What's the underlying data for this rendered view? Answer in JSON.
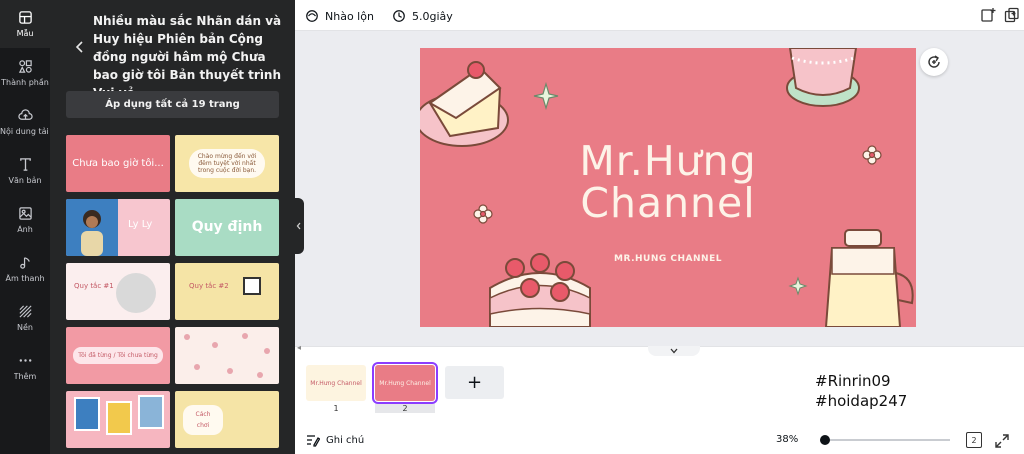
{
  "rail": {
    "items": [
      {
        "label": "Mẫu",
        "icon": "template-icon",
        "active": true
      },
      {
        "label": "Thành phần",
        "icon": "elements-icon"
      },
      {
        "label": "Nội dung tải lên",
        "icon": "upload-cloud-icon"
      },
      {
        "label": "Văn bản",
        "icon": "text-icon"
      },
      {
        "label": "Ảnh",
        "icon": "photo-icon"
      },
      {
        "label": "Âm thanh",
        "icon": "music-icon"
      },
      {
        "label": "Nền",
        "icon": "background-icon"
      },
      {
        "label": "Thêm",
        "icon": "more-icon"
      }
    ]
  },
  "panel": {
    "title": "Nhiều màu sắc Nhãn dán và Huy hiệu Phiên bản Cộng đồng người hâm mộ Chưa bao giờ tôi Bản thuyết trình Vui vẻ",
    "apply_label": "Áp dụng tất cả 19 trang",
    "thumbnails": [
      {
        "text": "Chưa bao giờ tôi...",
        "bg": "#e97c86",
        "fg": "#ffffff"
      },
      {
        "text": "Chào mừng đến với đêm tuyệt vời nhất trong cuộc đời bạn.",
        "bg": "#f7e6a8",
        "fg": "#8a5a3a"
      },
      {
        "text": "",
        "bg": "#3d7fc0",
        "fg": "#ffffff"
      },
      {
        "text": "Quy định",
        "bg": "#a9dcc4",
        "fg": "#ffffff"
      },
      {
        "text": "Quy tắc #1",
        "bg": "#fbeeee",
        "fg": "#c45a66"
      },
      {
        "text": "Quy tắc #2",
        "bg": "#f5e4a6",
        "fg": "#c45a66"
      },
      {
        "text": "Tôi đã từng / Tôi chưa từng",
        "bg": "#f29aa4",
        "fg": "#ffffff"
      },
      {
        "text": "",
        "bg": "#fbeeea",
        "fg": "#c45a66"
      },
      {
        "text": "",
        "bg": "#f6b6c0",
        "fg": "#ffffff"
      },
      {
        "text": "Cách chơi",
        "bg": "#f5e4a6",
        "fg": "#c45a66"
      }
    ],
    "thumb_ly_text": "Ly Ly"
  },
  "topbar": {
    "shuffle_label": "Nhào lộn",
    "timer_label": "5.0giây"
  },
  "slide": {
    "title_line1": "Mr.Hưng",
    "title_line2": "Channel",
    "subtitle": "MR.HUNG CHANNEL",
    "background": "#e97c86"
  },
  "pages": [
    {
      "number": "1",
      "thumb_text": "Mr.Hưng Channel",
      "bg": "#fdf4e0"
    },
    {
      "number": "2",
      "thumb_text": "Mr.Hưng Channel",
      "bg": "#e97c86",
      "selected": true
    }
  ],
  "add_page_symbol": "+",
  "watermark": {
    "line1": "#Rinrin09",
    "line2": "#hoidap247"
  },
  "footer": {
    "notes_label": "Ghi chú",
    "zoom": "38%",
    "zoom_fraction": 0.0,
    "page_count": "2"
  },
  "colors": {
    "accent": "#8b3dff",
    "slide_pink": "#e97c86",
    "cream": "#fdf3e8"
  }
}
